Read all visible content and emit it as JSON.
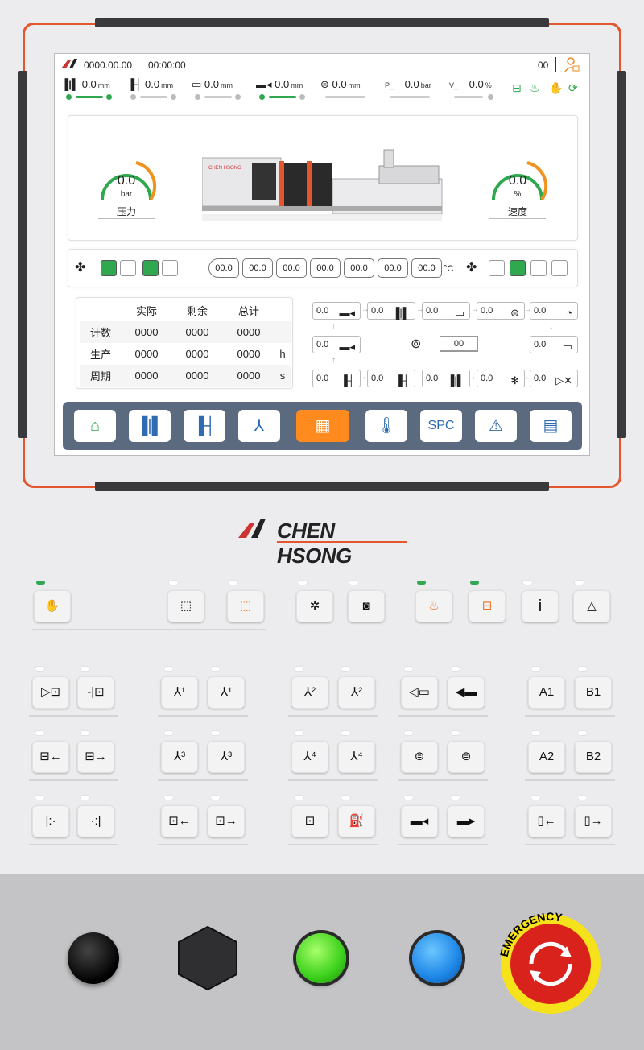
{
  "status": {
    "date": "0000.00.00",
    "time": "00:00:00",
    "counter": "00"
  },
  "params": [
    {
      "value": "0.0",
      "unit": "mm",
      "icon": "mold-open-icon"
    },
    {
      "value": "0.0",
      "unit": "mm",
      "icon": "ejector-icon"
    },
    {
      "value": "0.0",
      "unit": "mm",
      "icon": "screw-icon"
    },
    {
      "value": "0.0",
      "unit": "mm",
      "icon": "injection-icon"
    },
    {
      "value": "0.0",
      "unit": "mm",
      "icon": "screw-rotate-icon"
    },
    {
      "prefix": "P_",
      "value": "0.0",
      "unit": "bar"
    },
    {
      "prefix": "V_",
      "value": "0.0",
      "unit": "%"
    }
  ],
  "gauges": {
    "pressure": {
      "value": "0.0",
      "unit": "bar",
      "label": "压力"
    },
    "speed": {
      "value": "0.0",
      "unit": "%",
      "label": "速度"
    }
  },
  "machine_brand": "CHEN HSONG",
  "heater": {
    "zones": [
      "00.0",
      "00.0",
      "00.0",
      "00.0",
      "00.0",
      "00.0",
      "00.0"
    ],
    "unit": "°C"
  },
  "counter_table": {
    "headers": [
      "实际",
      "剩余",
      "总计"
    ],
    "rows": [
      {
        "label": "计数",
        "values": [
          "0000",
          "0000",
          "0000"
        ],
        "unit": ""
      },
      {
        "label": "生产",
        "values": [
          "0000",
          "0000",
          "0000"
        ],
        "unit": "h"
      },
      {
        "label": "周期",
        "values": [
          "0000",
          "0000",
          "0000"
        ],
        "unit": "s"
      }
    ]
  },
  "cycle": {
    "steps": [
      "0.0",
      "0.0",
      "0.0",
      "0.0",
      "0.0",
      "0.0",
      "0.0",
      "0.0",
      "0.0",
      "0.0",
      "0.0",
      "0.0",
      "0.0",
      "0.0"
    ],
    "center_value": "00"
  },
  "nav": [
    "home-icon",
    "mold-icon",
    "ejector-icon",
    "core-pull-icon",
    "menu-grid-icon",
    "thermometer-icon",
    "SPC",
    "warning-icon",
    "monitor-icon"
  ],
  "keys": {
    "a1": "A1",
    "b1": "B1",
    "a2": "A2",
    "b2": "B2"
  },
  "estop_text": "EMERGENCY",
  "colors": {
    "accent": "#e4572e",
    "green": "#2fa84f",
    "nav_selected": "#ff8a1e",
    "nav_bar": "#5c6a80"
  }
}
